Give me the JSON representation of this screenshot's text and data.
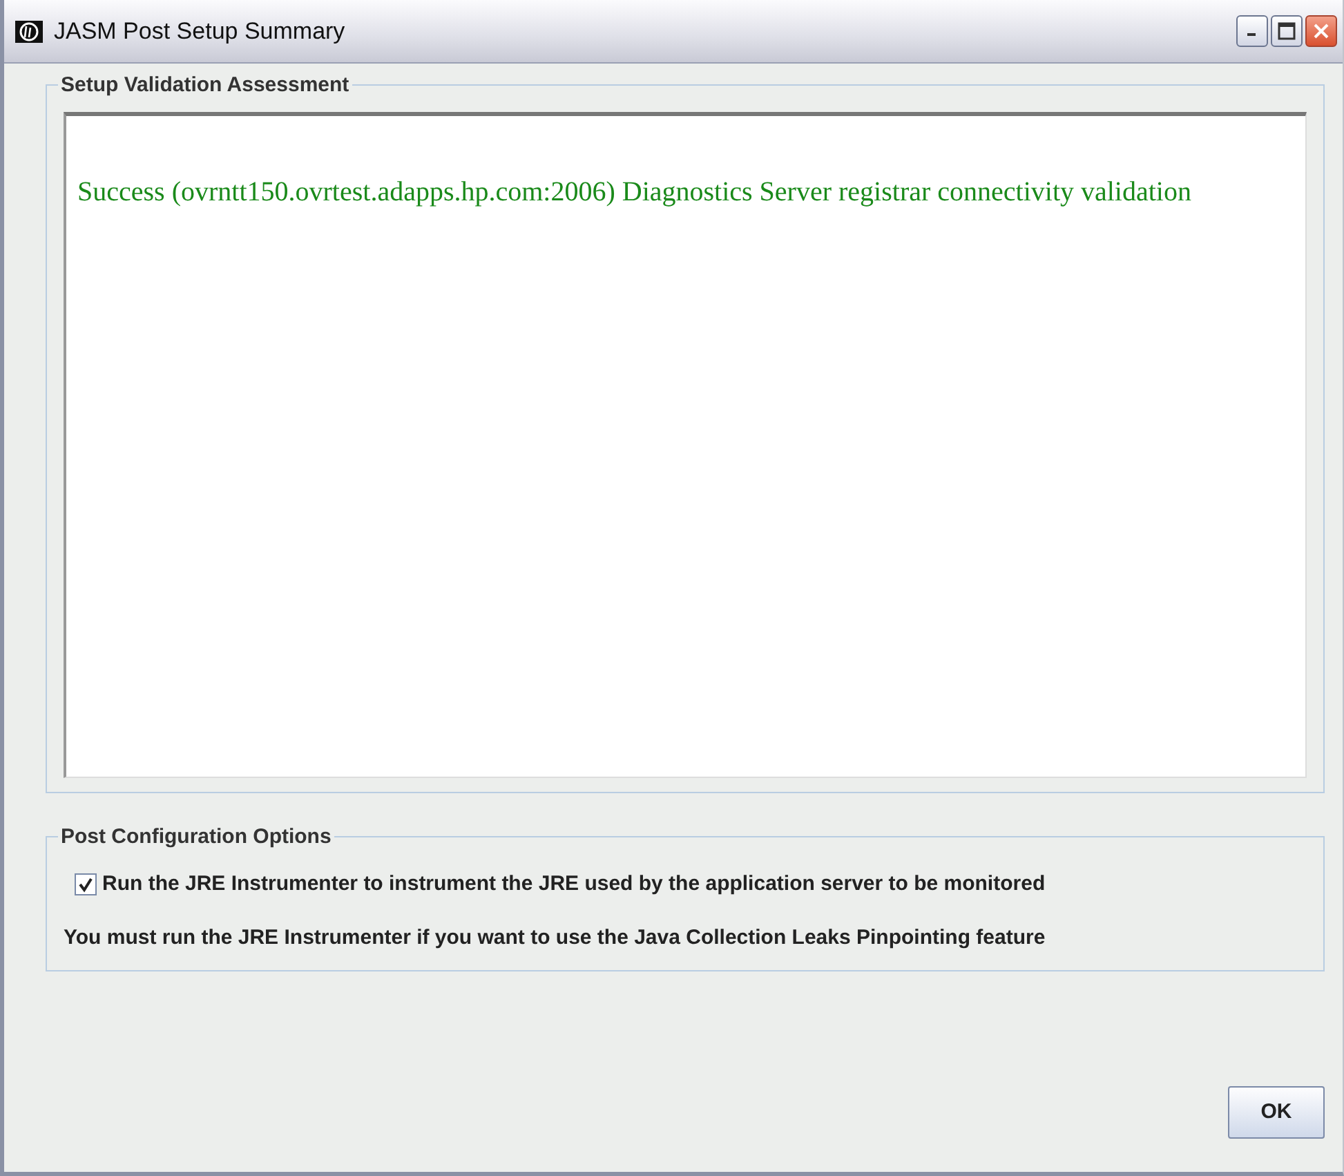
{
  "window": {
    "title": "JASM Post Setup Summary"
  },
  "validation": {
    "title": "Setup Validation Assessment",
    "messages": [
      {
        "text": "Success (ovrntt150.ovrtest.adapps.hp.com:2006) Diagnostics Server registrar connectivity validation",
        "color": "#1a8a1a"
      }
    ]
  },
  "post_config": {
    "title": "Post Configuration Options",
    "option": {
      "label": "Run the JRE Instrumenter to instrument the JRE used by the application server to be monitored",
      "checked": true
    },
    "note": "You must run the JRE Instrumenter if you want to use the Java Collection Leaks Pinpointing feature"
  },
  "buttons": [
    {
      "label": "OK"
    }
  ]
}
